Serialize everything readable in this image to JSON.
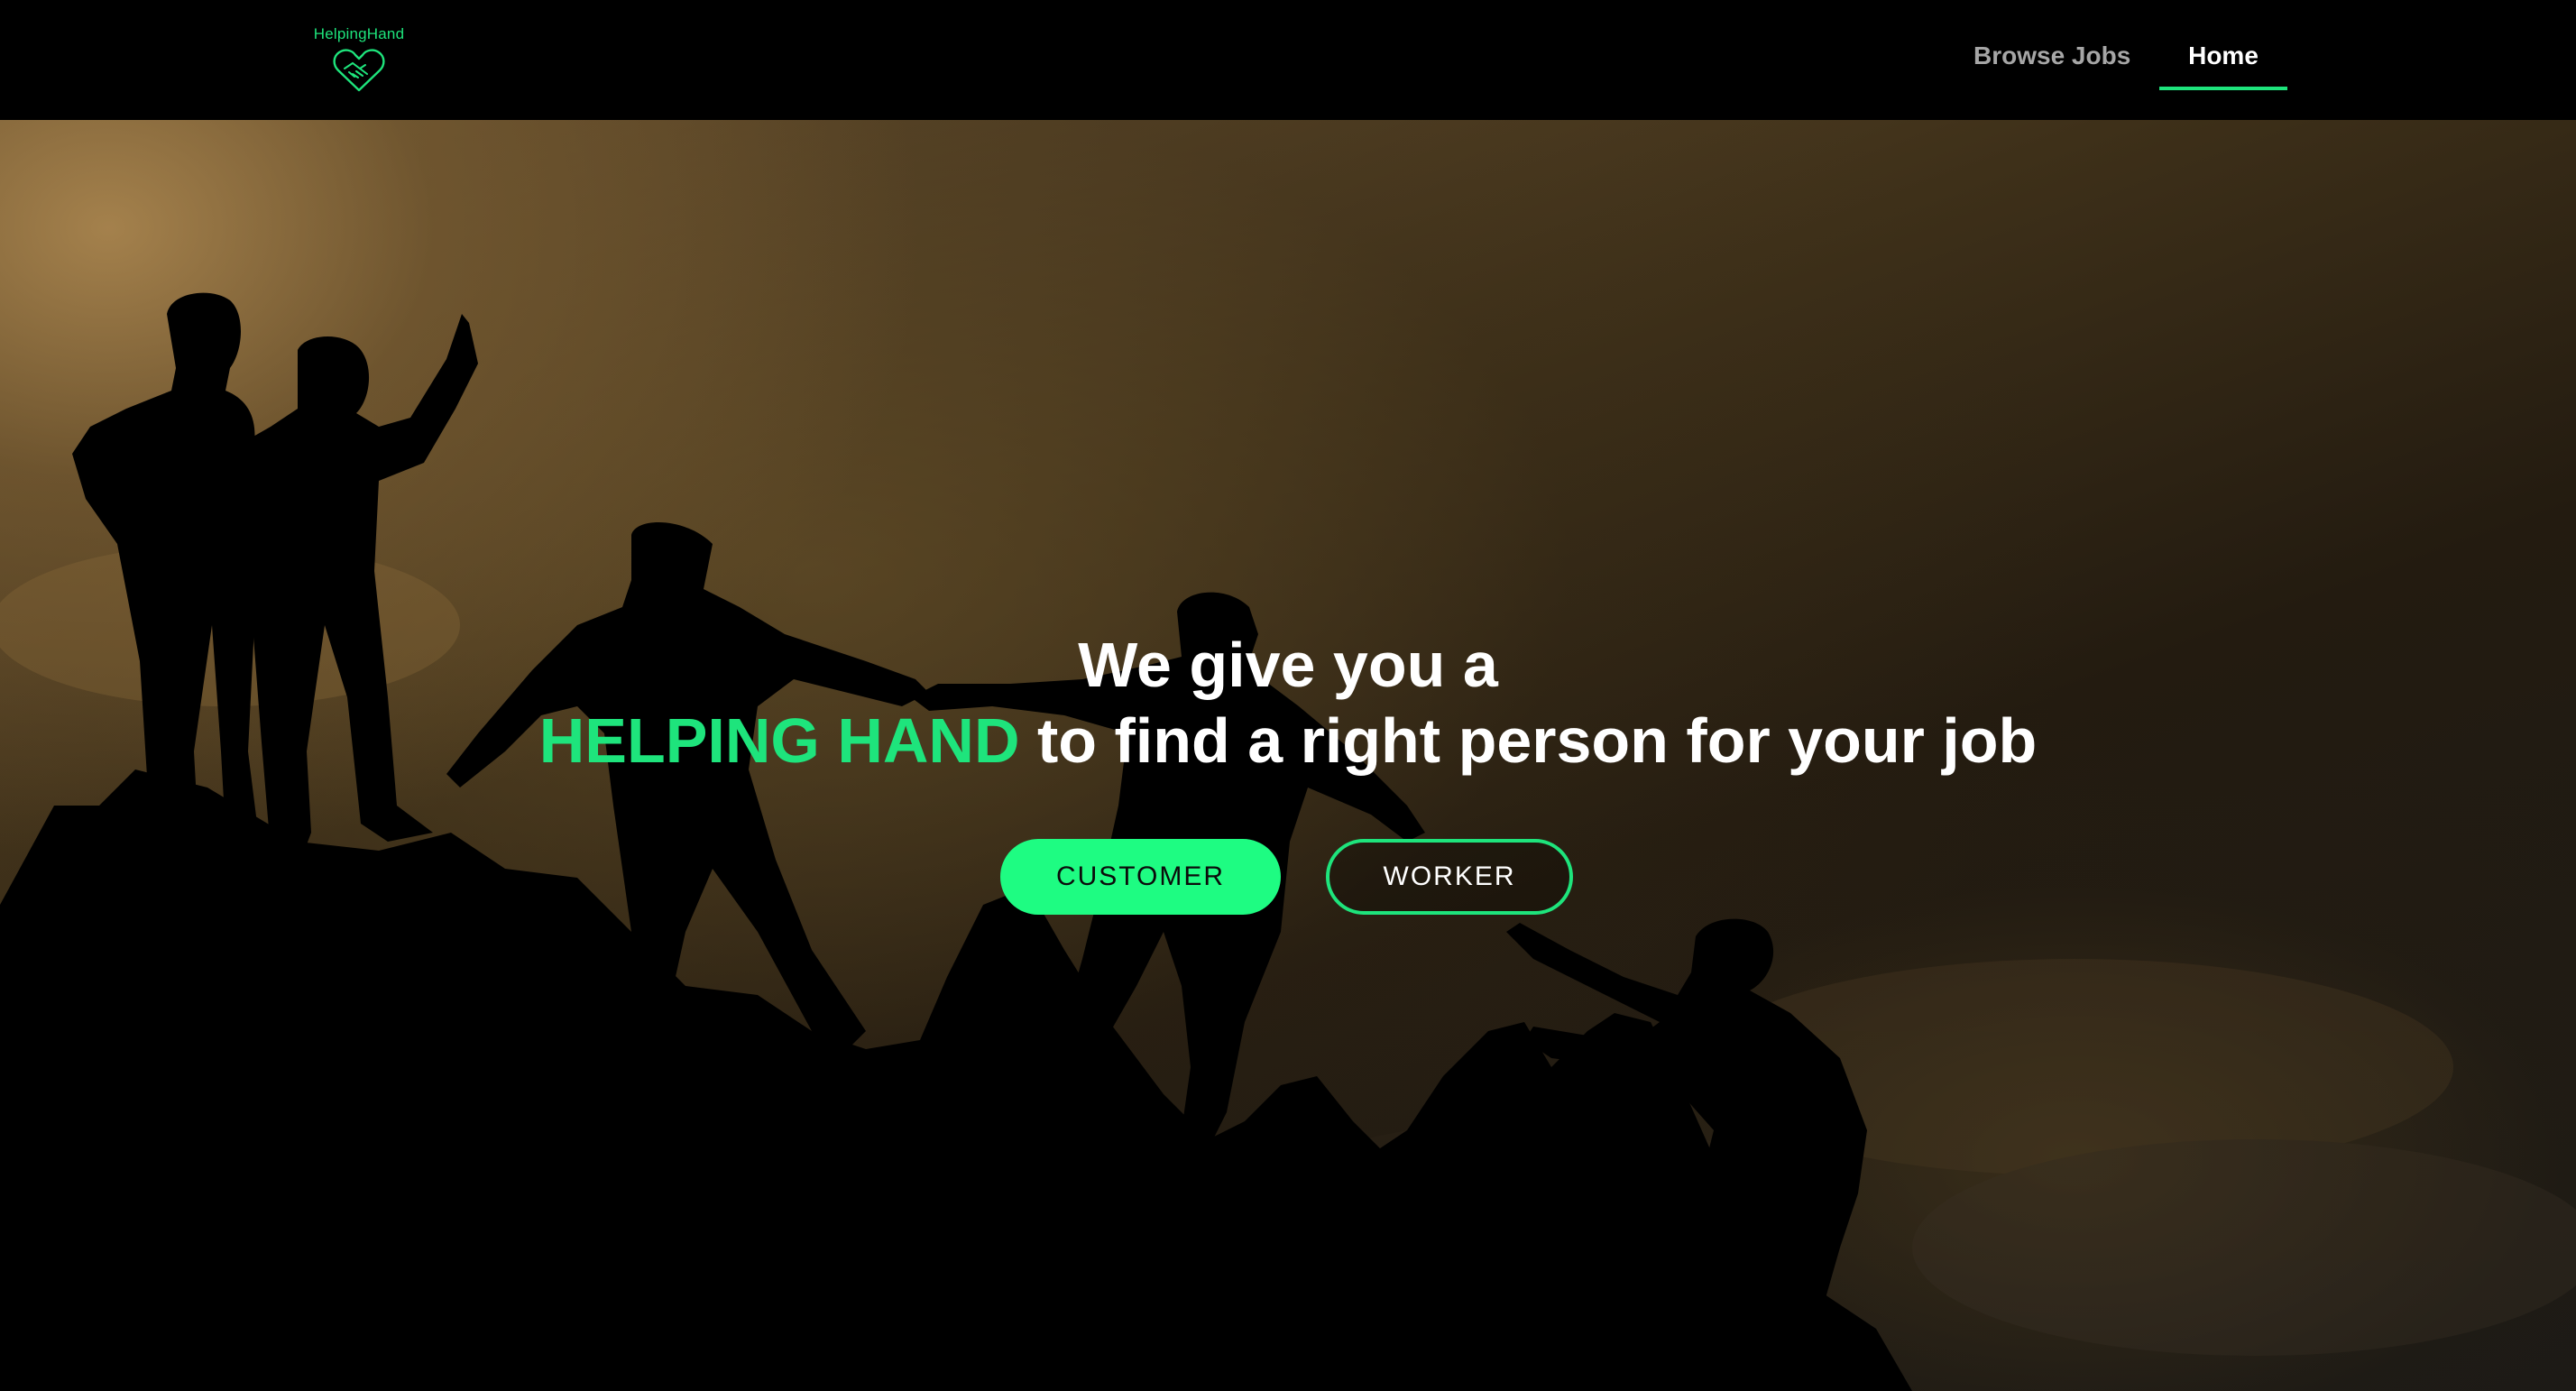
{
  "brand": {
    "name": "HelpingHand",
    "logo_icon": "heart-handshake-icon",
    "accent_color": "#1ee47c"
  },
  "nav": {
    "items": [
      {
        "label": "Browse Jobs",
        "active": false
      },
      {
        "label": "Home",
        "active": true
      }
    ]
  },
  "hero": {
    "line1": "We give you a",
    "highlight": "HELPING HAND",
    "line2_rest": " to find a right person for your job",
    "background": "silhouettes-helping-climb-mountain-image"
  },
  "buttons": {
    "customer": "CUSTOMER",
    "worker": "WORKER"
  }
}
